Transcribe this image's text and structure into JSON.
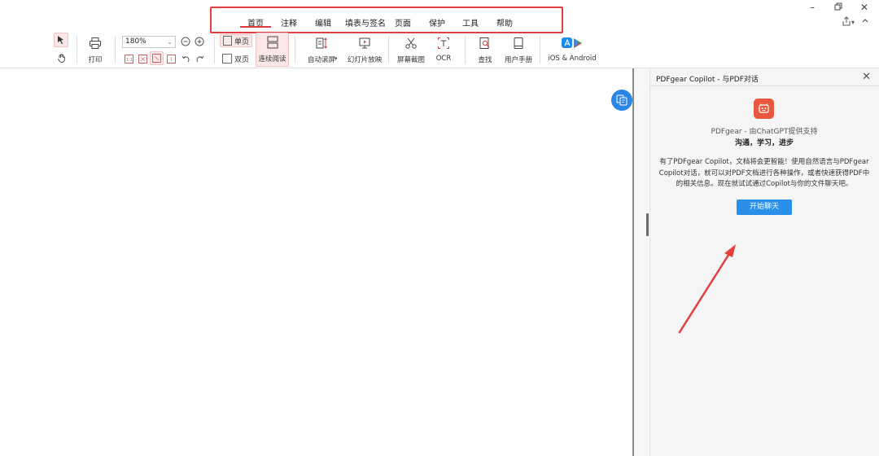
{
  "menu": {
    "items": [
      {
        "label": "首页",
        "active": true
      },
      {
        "label": "注释"
      },
      {
        "label": "编辑"
      },
      {
        "label": "填表与签名"
      },
      {
        "label": "页面"
      },
      {
        "label": "保护"
      },
      {
        "label": "工具"
      },
      {
        "label": "帮助"
      }
    ]
  },
  "toolbar": {
    "print_label": "打印",
    "zoom_value": "180%",
    "single_page_label": "单页",
    "double_page_label": "双页",
    "continuous_label": "连续阅读",
    "auto_scroll_label": "自动滚屏",
    "slideshow_label": "幻灯片放映",
    "screenshot_label": "屏幕截图",
    "ocr_label": "OCR",
    "find_label": "查找",
    "manual_label": "用户手册",
    "mobile_label": "iOS & Android"
  },
  "copilot": {
    "title": "PDFgear Copilot - 与PDF对话",
    "powered_by": "PDFgear - 由ChatGPT提供支持",
    "tagline": "沟通，学习，进步",
    "description": "有了PDFgear Copilot，文档将会更智能！使用自然语言与PDFgear Copilot对话，就可以对PDF文档进行各种操作，或者快速获得PDF中的相关信息。现在就试试通过Copilot与你的文件聊天吧。",
    "start_button": "开始聊天"
  },
  "colors": {
    "accent_red": "#e24040",
    "brand_blue": "#2a8fe8",
    "bot_logo": "#e8573e"
  }
}
